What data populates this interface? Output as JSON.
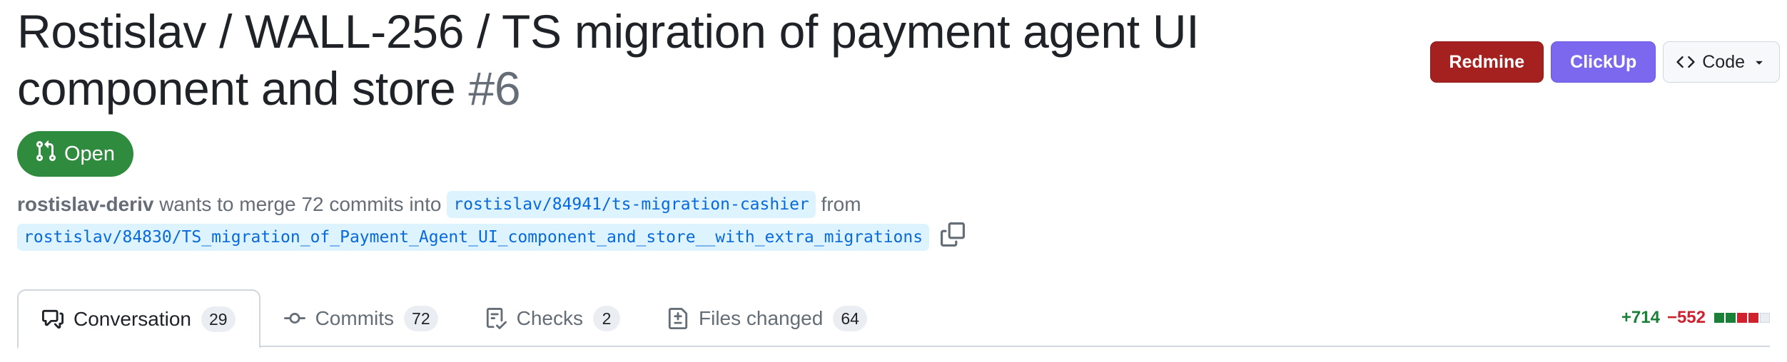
{
  "pr": {
    "title": "Rostislav / WALL-256 / TS migration of payment agent UI component and store",
    "number": "#6",
    "state": "Open",
    "author": "rostislav-deriv",
    "action_text": "wants to merge 72 commits into",
    "base_branch": "rostislav/84941/ts-migration-cashier",
    "from_text": "from",
    "head_branch": "rostislav/84830/TS_migration_of_Payment_Agent_UI_component_and_store__with_extra_migrations"
  },
  "actions": {
    "redmine_label": "Redmine",
    "clickup_label": "ClickUp",
    "code_label": "Code"
  },
  "tabs": [
    {
      "label": "Conversation",
      "count": "29",
      "icon": "comment-discussion-icon",
      "active": true
    },
    {
      "label": "Commits",
      "count": "72",
      "icon": "git-commit-icon",
      "active": false
    },
    {
      "label": "Checks",
      "count": "2",
      "icon": "checklist-icon",
      "active": false
    },
    {
      "label": "Files changed",
      "count": "64",
      "icon": "file-diff-icon",
      "active": false
    }
  ],
  "diffstat": {
    "additions": "+714",
    "deletions": "−552",
    "blocks": [
      "green",
      "green",
      "red",
      "red",
      "neutral"
    ]
  },
  "colors": {
    "open_badge": "#2f8b3d",
    "redmine": "#a4211f",
    "clickup": "#7b68ee",
    "additions": "#1a7f37",
    "deletions": "#cf222e",
    "branch_text": "#0969da",
    "branch_bg": "#ddf4ff"
  }
}
